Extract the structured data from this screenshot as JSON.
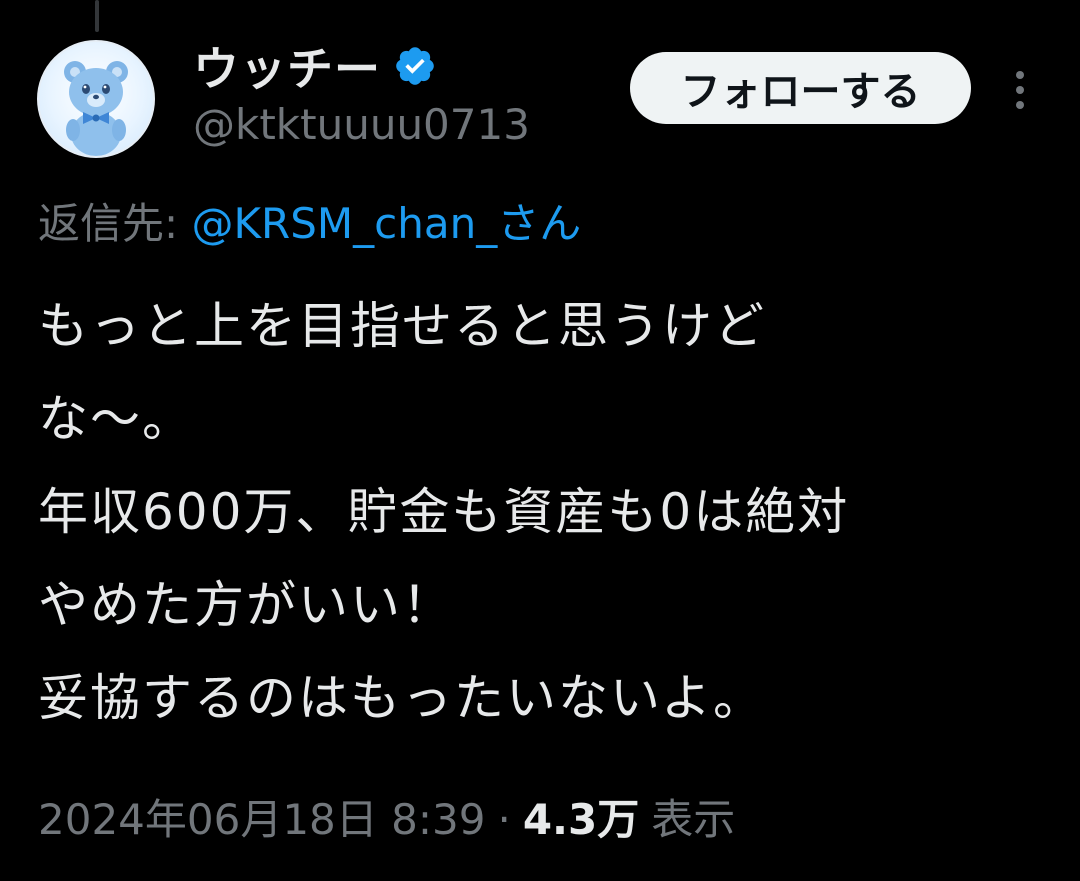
{
  "author": {
    "display_name": "ウッチー",
    "handle": "@ktktuuuu0713",
    "verified": true,
    "avatar_icon": "bear-avatar"
  },
  "actions": {
    "follow_label": "フォローする",
    "more_icon": "more-vertical-icon"
  },
  "reply_to": {
    "prefix": "返信先: ",
    "mention": "@KRSM_chan_さん"
  },
  "tweet": {
    "lines": [
      "もっと上を目指せると思うけど",
      "な〜。",
      "年収600万、貯金も資産も0は絶対",
      "やめた方がいい！",
      "妥協するのはもったいないよ。"
    ]
  },
  "meta": {
    "timestamp": "2024年06月18日 8:39",
    "separator": "·",
    "views_count": "4.3万",
    "views_label": "表示"
  },
  "colors": {
    "background": "#000000",
    "text": "#e7e9ea",
    "muted": "#71767b",
    "accent": "#1d9bf0",
    "follow_bg": "#eff3f4"
  }
}
